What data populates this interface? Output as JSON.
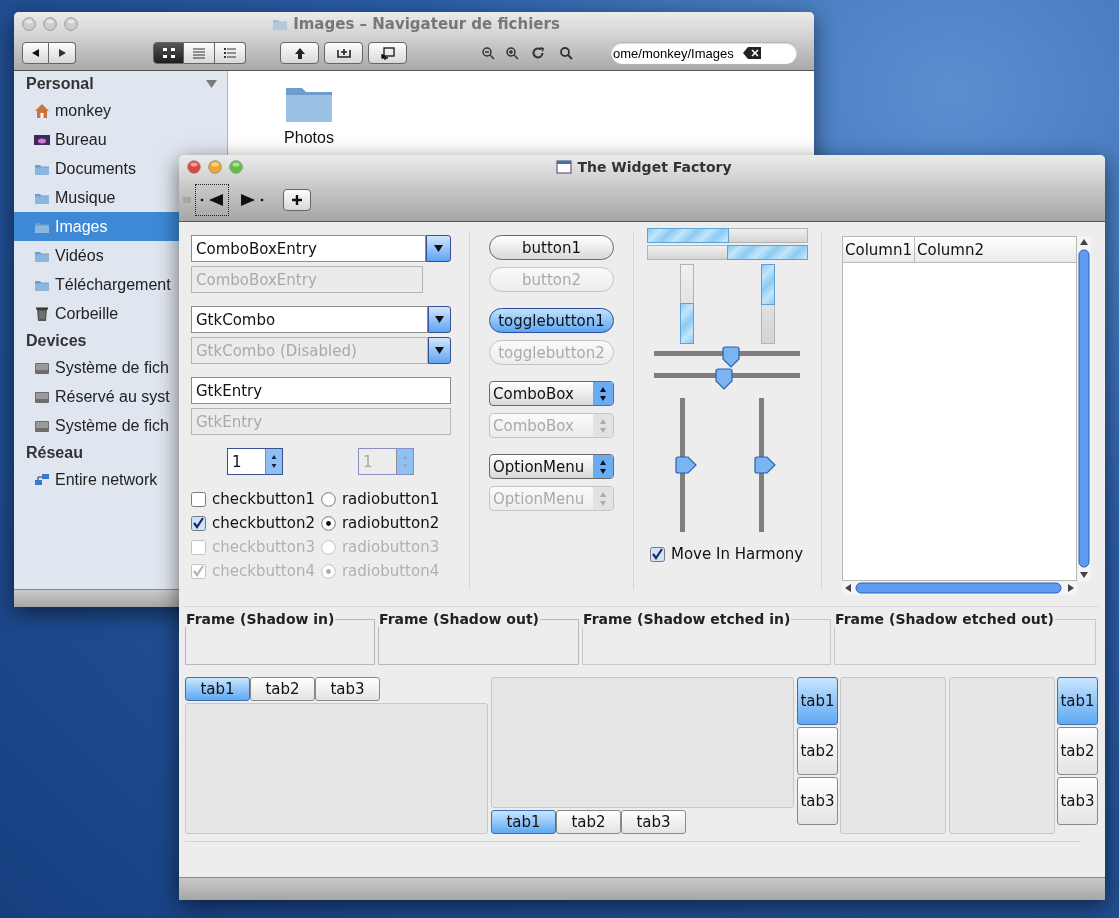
{
  "file_browser": {
    "title": "Images – Navigateur de fichiers",
    "location": "ome/monkey/Images",
    "view_modes": [
      {
        "selected": true
      },
      {
        "selected": false
      },
      {
        "selected": false
      }
    ],
    "sidebar": [
      {
        "heading": "Personal",
        "items": [
          {
            "label": "monkey",
            "kind": "home",
            "selected": false
          },
          {
            "label": "Bureau",
            "kind": "desktop",
            "selected": false
          },
          {
            "label": "Documents",
            "kind": "folder",
            "selected": false
          },
          {
            "label": "Musique",
            "kind": "folder",
            "selected": false
          },
          {
            "label": "Images",
            "kind": "folder",
            "selected": true
          },
          {
            "label": "Vidéos",
            "kind": "folder",
            "selected": false
          },
          {
            "label": "Téléchargement",
            "kind": "folder",
            "selected": false
          },
          {
            "label": "Corbeille",
            "kind": "trash",
            "selected": false
          }
        ]
      },
      {
        "heading": "Devices",
        "items": [
          {
            "label": "Système de fich",
            "kind": "drive",
            "selected": false
          },
          {
            "label": "Réservé au syst",
            "kind": "drive",
            "selected": false
          },
          {
            "label": "Système de fich",
            "kind": "drive",
            "selected": false
          }
        ]
      },
      {
        "heading": "Réseau",
        "items": [
          {
            "label": "Entire network",
            "kind": "network",
            "selected": false
          }
        ]
      }
    ],
    "files": [
      {
        "name": "Photos"
      }
    ]
  },
  "widget_factory": {
    "title": "The Widget Factory",
    "fields": [
      {
        "kind": "combo_entry",
        "value": "ComboBoxEntry",
        "disabled": false,
        "button": true
      },
      {
        "kind": "combo_entry",
        "value": "ComboBoxEntry",
        "disabled": true,
        "button": false
      },
      {
        "kind": "combo",
        "value": "GtkCombo",
        "disabled": false,
        "button": true
      },
      {
        "kind": "combo",
        "value": "GtkCombo (Disabled)",
        "disabled": true,
        "button": true
      },
      {
        "kind": "entry",
        "value": "GtkEntry",
        "disabled": false,
        "button": false
      },
      {
        "kind": "entry",
        "value": "GtkEntry",
        "disabled": true,
        "button": false
      }
    ],
    "spins": [
      {
        "value": "1",
        "disabled": false
      },
      {
        "value": "1",
        "disabled": true
      }
    ],
    "checks": [
      {
        "label": "checkbutton1",
        "checked": false,
        "disabled": false
      },
      {
        "label": "checkbutton2",
        "checked": true,
        "disabled": false
      },
      {
        "label": "checkbutton3",
        "checked": false,
        "disabled": true
      },
      {
        "label": "checkbutton4",
        "checked": true,
        "disabled": true
      }
    ],
    "radios": [
      {
        "label": "radiobutton1",
        "selected": false,
        "disabled": false
      },
      {
        "label": "radiobutton2",
        "selected": true,
        "disabled": false
      },
      {
        "label": "radiobutton3",
        "selected": false,
        "disabled": true
      },
      {
        "label": "radiobutton4",
        "selected": true,
        "disabled": true
      }
    ],
    "buttons": [
      {
        "kind": "button",
        "label": "button1",
        "disabled": false
      },
      {
        "kind": "button",
        "label": "button2",
        "disabled": true
      },
      {
        "kind": "toggle",
        "label": "togglebutton1",
        "on": true,
        "disabled": false
      },
      {
        "kind": "toggle",
        "label": "togglebutton2",
        "on": false,
        "disabled": true
      },
      {
        "kind": "combo",
        "label": "ComboBox",
        "disabled": false
      },
      {
        "kind": "combo",
        "label": "ComboBox",
        "disabled": true
      },
      {
        "kind": "combo",
        "label": "OptionMenu",
        "disabled": false
      },
      {
        "kind": "combo",
        "label": "OptionMenu",
        "disabled": true
      }
    ],
    "hprogress": [
      {
        "level": 0.5,
        "inverted": false
      },
      {
        "level": 0.5,
        "inverted": true
      }
    ],
    "vprogress": [
      {
        "level": 0.5,
        "inverted": true
      },
      {
        "level": 0.5,
        "inverted": false
      }
    ],
    "hscales": [
      {
        "level": 0.53
      },
      {
        "level": 0.48
      }
    ],
    "vscales": [
      {
        "level": 0.5
      },
      {
        "level": 0.5
      }
    ],
    "harmony": {
      "label": "Move In Harmony",
      "checked": true
    },
    "tree": {
      "columns": [
        "Column1",
        "Column2"
      ]
    },
    "frames": [
      {
        "label": "Frame (Shadow in)"
      },
      {
        "label": "Frame (Shadow out)"
      },
      {
        "label": "Frame (Shadow etched in)"
      },
      {
        "label": "Frame (Shadow etched out)"
      }
    ],
    "notebooks": [
      {
        "kind": "top",
        "tabs": [
          {
            "label": "tab1",
            "selected": true
          },
          {
            "label": "tab2",
            "selected": false
          },
          {
            "label": "tab3",
            "selected": false
          }
        ]
      },
      {
        "kind": "bottom",
        "tabs": [
          {
            "label": "tab1",
            "selected": true
          },
          {
            "label": "tab2",
            "selected": false
          },
          {
            "label": "tab3",
            "selected": false
          }
        ]
      },
      {
        "kind": "left",
        "tabs": [
          {
            "label": "tab1",
            "selected": true
          },
          {
            "label": "tab2",
            "selected": false
          },
          {
            "label": "tab3",
            "selected": false
          }
        ]
      },
      {
        "kind": "right",
        "tabs": [
          {
            "label": "tab1",
            "selected": true
          },
          {
            "label": "tab2",
            "selected": false
          },
          {
            "label": "tab3",
            "selected": false
          }
        ]
      }
    ]
  }
}
